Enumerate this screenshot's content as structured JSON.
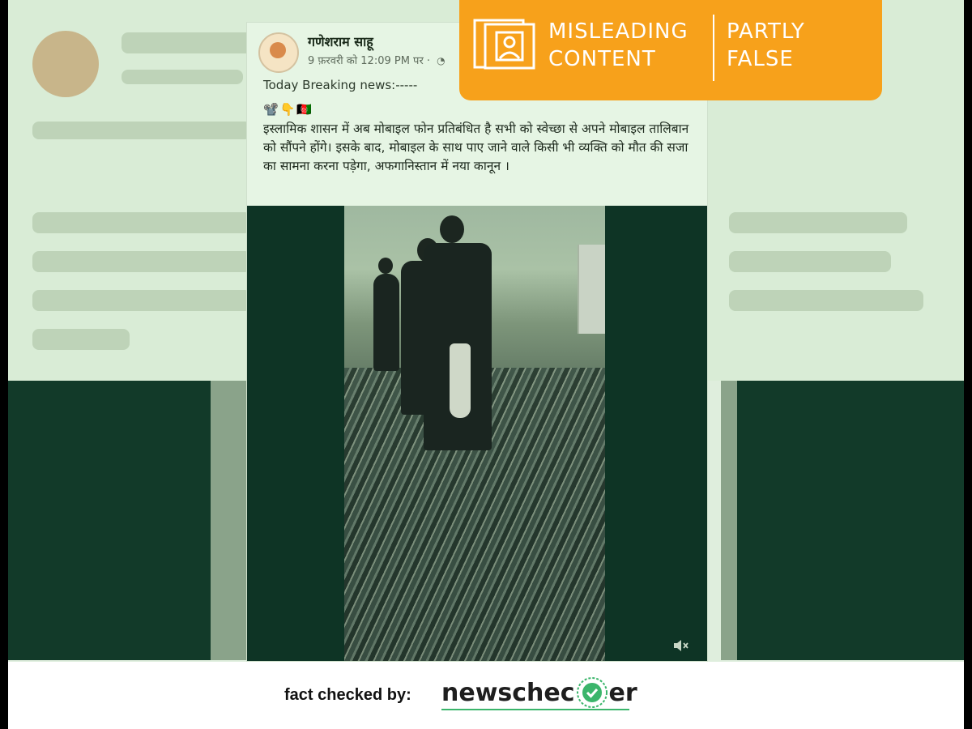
{
  "post": {
    "author": "गणेशराम साहू",
    "meta": "9 फ़रवरी को 12:09 PM पर ·",
    "headline": "Today Breaking news:-----",
    "emojis": "📽️👇🇦🇫",
    "body": "इस्लामिक शासन में अब मोबाइल फोन प्रतिबंधित है सभी को स्वेच्छा से अपने मोबाइल तालिबान को सौंपने होंगे। इसके बाद, मोबाइल के साथ पाए जाने वाले किसी भी व्यक्ति को मौत की सजा का सामना करना पड़ेगा, अफगानिस्तान में नया कानून ।"
  },
  "badge": {
    "left_line1": "MISLEADING",
    "left_line2": "CONTENT",
    "right_line1": "PARTLY",
    "right_line2": "FALSE",
    "color": "#f7a11b"
  },
  "footer": {
    "label": "fact checked by:",
    "brand_part1": "newschec",
    "brand_part2": "er",
    "accent": "#3bb56b"
  },
  "icons": {
    "badge_icon": "photo-frame-person-icon",
    "mute_icon": "speaker-muted-icon",
    "check_icon": "check-badge-icon"
  }
}
